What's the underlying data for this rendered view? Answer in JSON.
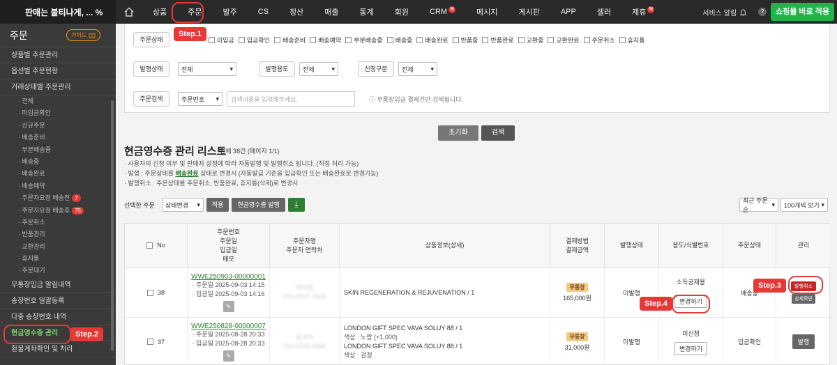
{
  "topbar": {
    "brand": "판매는 불티나게, ... %",
    "nav": [
      {
        "label": "상품"
      },
      {
        "label": "주문"
      },
      {
        "label": "발주"
      },
      {
        "label": "CS"
      },
      {
        "label": "정산"
      },
      {
        "label": "매출"
      },
      {
        "label": "통계"
      },
      {
        "label": "회원"
      },
      {
        "label": "CRM",
        "badge": "N"
      },
      {
        "label": "메시지"
      },
      {
        "label": "게시판"
      },
      {
        "label": "APP"
      },
      {
        "label": "셀러"
      },
      {
        "label": "제휴",
        "badge": "N"
      }
    ],
    "service_alert": "서비스 알림",
    "help": "?",
    "apply_button": "쇼핑몰 바로 적용"
  },
  "sidebar": {
    "title": "주문",
    "guide": "가이드",
    "items": [
      {
        "label": "상품별 주문관리",
        "kind": "sec"
      },
      {
        "label": "옵션별 주문현황",
        "kind": "sec"
      },
      {
        "label": "거래상태별 주문관리",
        "kind": "sec"
      },
      {
        "label": "· 전체",
        "kind": "sub"
      },
      {
        "label": "· 미입금확인",
        "kind": "sub"
      },
      {
        "label": "· 신규주문",
        "kind": "sub"
      },
      {
        "label": "· 배송준비",
        "kind": "sub"
      },
      {
        "label": "· 부분배송중",
        "kind": "sub"
      },
      {
        "label": "· 배송중",
        "kind": "sub"
      },
      {
        "label": "· 배송완료",
        "kind": "sub"
      },
      {
        "label": "· 배송예약",
        "kind": "sub"
      },
      {
        "label": "· 주문자요청 배송전",
        "kind": "sub",
        "count": "7"
      },
      {
        "label": "· 주문자요청 배송후",
        "kind": "sub",
        "count": "75"
      },
      {
        "label": "· 주문취소",
        "kind": "sub"
      },
      {
        "label": "· 반품관리",
        "kind": "sub"
      },
      {
        "label": "· 교환관리",
        "kind": "sub"
      },
      {
        "label": "· 휴지통",
        "kind": "sub"
      },
      {
        "label": "· 주문대기",
        "kind": "sub"
      },
      {
        "label": "무통장입금 알림내역",
        "kind": "sec"
      },
      {
        "label": "송장번호 일괄등록",
        "kind": "sec"
      },
      {
        "label": "다중 송장번호 내역",
        "kind": "sec"
      },
      {
        "label": "현금영수증 관리",
        "kind": "sec",
        "active": true
      },
      {
        "label": "환불계좌확인 및 처리",
        "kind": "sec"
      }
    ]
  },
  "filter": {
    "order_status_label": "주문상태",
    "statuses": [
      "미입금",
      "입금확인",
      "배송준비",
      "배송예약",
      "부분배송중",
      "배송중",
      "배송완료",
      "반품중",
      "반품완료",
      "교환중",
      "교환완료",
      "주문취소",
      "휴지통"
    ],
    "issue_status_label": "발행상태",
    "issue_status_value": "전체",
    "purpose_label": "발행용도",
    "purpose_value": "전체",
    "request_label": "신청구분",
    "request_value": "전체",
    "search_label": "주문검색",
    "search_type": "주문번호",
    "search_placeholder": "검색내용을 입력해주세요.",
    "search_hint": "ⓘ 무통장입금 결제건만 검색됩니다."
  },
  "buttons": {
    "reset": "초기화",
    "search": "검색"
  },
  "list": {
    "title": "현금영수증 관리 리스트",
    "count_text": "전체 38건 (페이지 1/1)",
    "notes": [
      "· 사용자의 신청 여부 및 판매자 설정에 따라 자동발행 및 발행취소 됩니다. (직접 처리 가능)",
      "· 발행취소 : 주문상태를 주문취소, 반품완료, 휴지통(삭제)로 변경시"
    ],
    "note_issue_prefix": "· 발행 : 주문상태를 ",
    "note_issue_link": "배송완료",
    "note_issue_suffix": " 상태로 변경시 (자동발급 기준을 입금확인 또는 배송완료로 변경가능)",
    "selected_label": "선택한 주문",
    "state_change": "상태변경",
    "apply": "적용",
    "issue_cash": "현금영수증 발행",
    "sort": "최근 주문순",
    "per_page": "100개씩 보기"
  },
  "table": {
    "headers": [
      "No",
      "주문번호\n주문일\n입금일\n메모",
      "주문자명\n주문자 연락처",
      "상품정보(상세)",
      "결제방법\n결제금액",
      "발행상태",
      "용도/식별번호",
      "주문상태",
      "관리"
    ],
    "rows": [
      {
        "no": "38",
        "order_no": "WWE250903-00000001",
        "order_date": "· 주문일 2025-09-03 14:15",
        "paid_date": "· 입금일 2025-09-03 14:16",
        "customer": "박이현",
        "phone": "010-0717-7904",
        "products": [
          "SKIN REGENERATION & REJUVENATION / 1"
        ],
        "pay_method": "무통장",
        "amount": "165,000원",
        "issue_status": "미발행",
        "purpose": "소득공제용",
        "change_btn": "변경하기",
        "order_status": "배송중",
        "cancel_btn": "발행취소",
        "detail_btn": "상세확인"
      },
      {
        "no": "37",
        "order_no": "WWE250828-00000007",
        "order_date": "· 주문일 2025-08-28 20:33",
        "paid_date": "· 입금일 2025-08-28 20:33",
        "customer": "윤서아",
        "phone": "010-6335-3388",
        "products": [
          "LONDON GIFT SPEC VAVA SOLUY 88 / 1",
          "색상 : 노랑 (+1,000)",
          "LONDON GIFT SPEC VAVA SOLUY 88 / 1",
          "색상 : 검정"
        ],
        "pay_method": "무통장",
        "amount": "31,000원",
        "issue_status": "미발행",
        "purpose": "미신청",
        "change_btn": "변경하기",
        "order_status": "입금확인",
        "issue_btn": "발행"
      }
    ]
  },
  "steps": {
    "s1": "Step.1",
    "s2": "Step.2",
    "s3": "Step.3",
    "s4": "Step.4"
  },
  "colors": {
    "accent_green": "#22b34a",
    "annotation_red": "#e53935",
    "topbar": "#2a2a2a",
    "sidebar": "#3a3a3a"
  }
}
